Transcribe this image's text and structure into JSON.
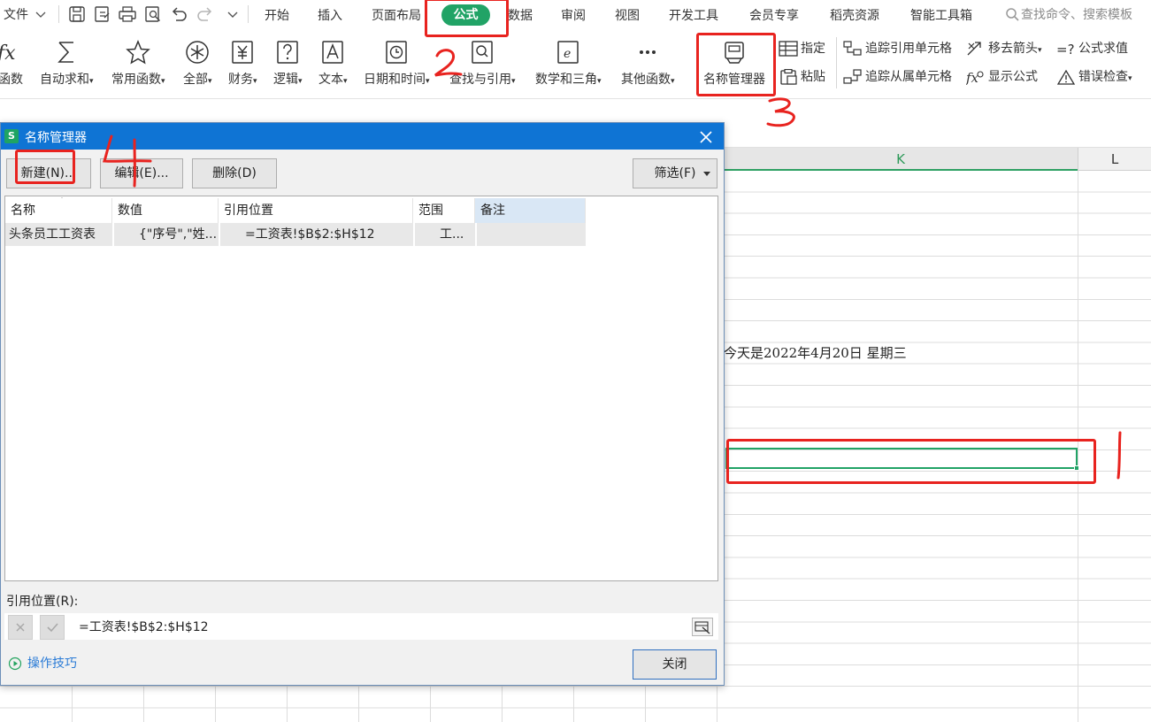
{
  "menubar": {
    "file_label": "文件",
    "tabs": [
      "开始",
      "插入",
      "页面布局",
      "公式",
      "数据",
      "审阅",
      "视图",
      "开发工具",
      "会员专享",
      "稻壳资源",
      "智能工具箱"
    ],
    "active_tab": "公式",
    "search_placeholder": "查找命令、搜索模板"
  },
  "ribbon": {
    "insert_function": "函数",
    "autosum": "自动求和",
    "common_functions": "常用函数",
    "all": "全部",
    "finance": "财务",
    "logic": "逻辑",
    "text": "文本",
    "date_time": "日期和时间",
    "lookup": "查找与引用",
    "math_trig": "数学和三角",
    "other_functions": "其他函数",
    "name_manager": "名称管理器",
    "assign": "指定",
    "paste": "粘贴",
    "trace_precedents": "追踪引用单元格",
    "trace_dependents": "追踪从属单元格",
    "remove_arrows": "移去箭头",
    "show_formulas": "显示公式",
    "evaluate_formula": "公式求值",
    "error_check": "错误检查"
  },
  "sheet": {
    "columns": [
      "K",
      "L"
    ],
    "date_text": "今天是2022年4月20日  星期三"
  },
  "dialog": {
    "title": "名称管理器",
    "buttons": {
      "new": "新建(N)...",
      "new_key": "N",
      "edit": "编辑(E)...",
      "edit_key": "E",
      "delete": "删除(D)",
      "delete_key": "D",
      "filter": "筛选(F)",
      "filter_key": "F",
      "close": "关闭"
    },
    "columns": [
      "名称",
      "数值",
      "引用位置",
      "范围",
      "备注"
    ],
    "rows": [
      {
        "name": "头条员工工资表",
        "value": "{\"序号\",\"姓...",
        "ref": "=工资表!$B$2:$H$12",
        "scope": "工...",
        "note": ""
      }
    ],
    "ref_label": "引用位置(R):",
    "ref_label_key": "R",
    "ref_value": "=工资表!$B$2:$H$12",
    "tips": "操作技巧"
  },
  "annotations": {
    "step1": "1",
    "step2": "2",
    "step3": "3",
    "step4": "4",
    "color": "#e8231f"
  },
  "colors": {
    "accent_green": "#21a366",
    "title_blue": "#0f74d4"
  }
}
